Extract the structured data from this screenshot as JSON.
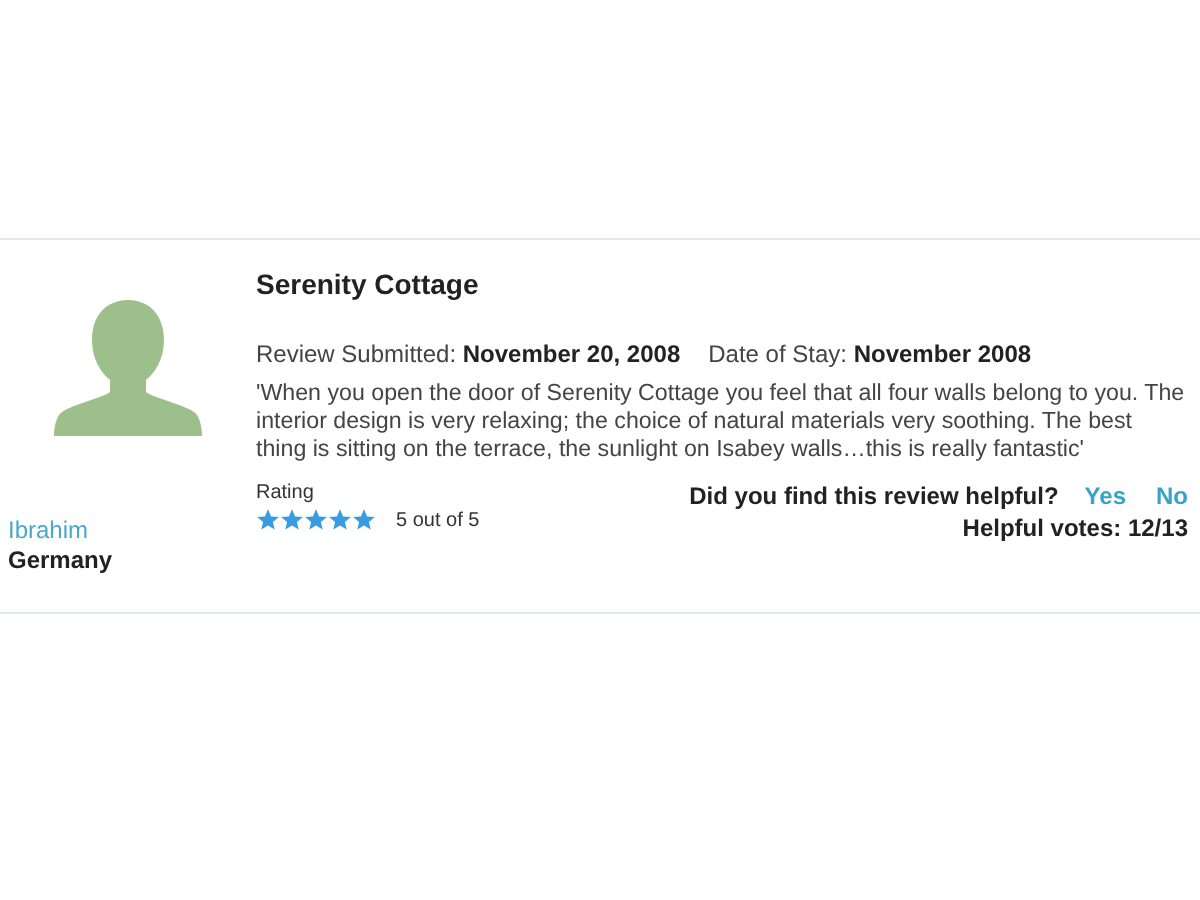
{
  "reviewer": {
    "name": "Ibrahim",
    "country": "Germany"
  },
  "review": {
    "title": "Serenity Cottage",
    "meta": [
      "Review Submitted: **November 20, 2008**",
      "Date of Stay: **November 2008**"
    ],
    "text": "'When you open the door of Serenity Cottage you feel that all four walls belong to you. The interior design is very relaxing; the choice of natural materials very soothing. The best thing is sitting on the terrace, the sunlight on Isabey walls…this is really fantastic'",
    "rating_label": "Rating",
    "stars": 5,
    "rating_text": "5 out of 5",
    "helpful_question": "Did you find this review helpful?",
    "helpful_options": [
      "Yes",
      "No"
    ],
    "helpful_votes": "Helpful votes: 12/13"
  }
}
